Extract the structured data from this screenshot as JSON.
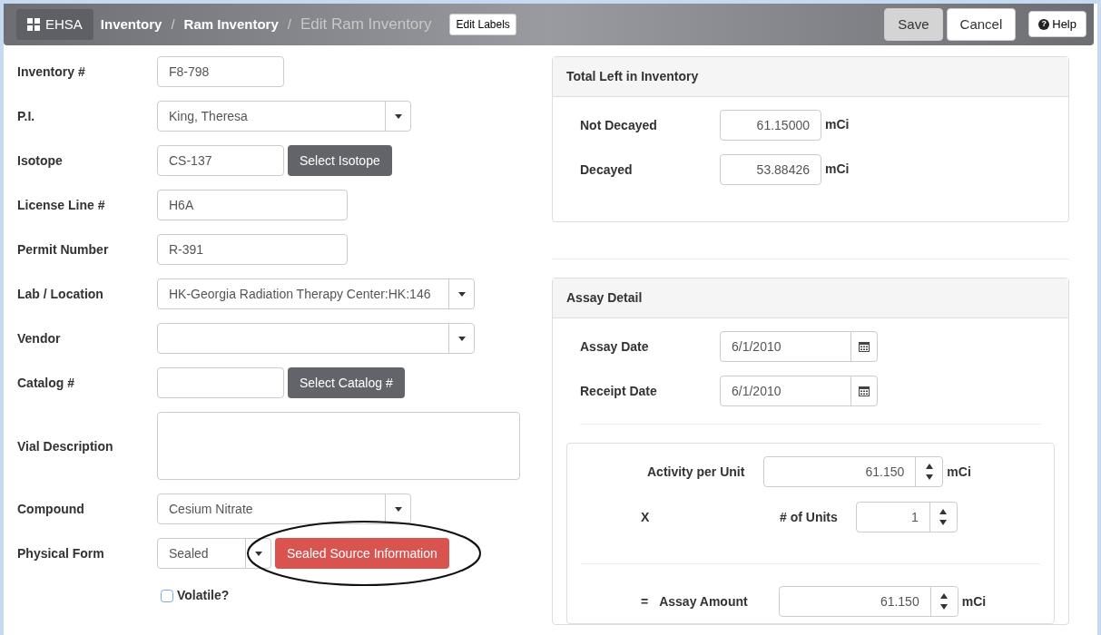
{
  "header": {
    "brand": "EHSA",
    "breadcrumbs": [
      {
        "label": "Inventory",
        "selected": false
      },
      {
        "label": "Ram Inventory",
        "selected": false
      },
      {
        "label": "Edit Ram Inventory",
        "selected": true
      }
    ],
    "separator": "/",
    "edit_labels": "Edit Labels",
    "buttons": [
      {
        "label": "Save",
        "selected": true
      },
      {
        "label": "Cancel",
        "selected": false
      }
    ],
    "help": "Help",
    "help_glyph": "?"
  },
  "form": [
    {
      "kind": "text",
      "label": "Inventory #",
      "value": "F8-798"
    },
    {
      "kind": "select",
      "label": "P.I.",
      "value": "King, Theresa"
    },
    {
      "kind": "text_button",
      "label": "Isotope",
      "value": "CS-137",
      "button": "Select Isotope"
    },
    {
      "kind": "text",
      "label": "License Line #",
      "value": "H6A"
    },
    {
      "kind": "text",
      "label": "Permit Number",
      "value": "R-391"
    },
    {
      "kind": "select",
      "label": "Lab / Location",
      "value": "HK-Georgia Radiation Therapy Center:HK:146"
    },
    {
      "kind": "select",
      "label": "Vendor"
    },
    {
      "kind": "text_button",
      "label": "Catalog #",
      "button": "Select Catalog #"
    },
    {
      "kind": "textarea",
      "label": "Vial Description"
    },
    {
      "kind": "select",
      "label": "Compound",
      "value": "Cesium Nitrate"
    },
    {
      "kind": "select_button",
      "label": "Physical Form",
      "value": "Sealed",
      "button": "Sealed Source Information"
    },
    {
      "kind": "checkbox",
      "label": "Volatile?",
      "checked": false
    }
  ],
  "total_left": {
    "title": "Total Left in Inventory",
    "rows": [
      {
        "label": "Not Decayed",
        "value": "61.15000",
        "unit": "mCi"
      },
      {
        "label": "Decayed",
        "value": "53.88426",
        "unit": "mCi"
      }
    ]
  },
  "assay_detail": {
    "title": "Assay Detail",
    "dates": [
      {
        "label": "Assay Date",
        "value": "6/1/2010"
      },
      {
        "label": "Receipt Date",
        "value": "6/1/2010"
      }
    ],
    "activity": {
      "label": "Activity per Unit",
      "value": "61.150",
      "unit": "mCi"
    },
    "units": {
      "operator": "X",
      "label": "# of Units",
      "value": "1"
    },
    "amount": {
      "operator": "=",
      "label": "Assay Amount",
      "value": "61.150",
      "unit": "mCi"
    }
  }
}
